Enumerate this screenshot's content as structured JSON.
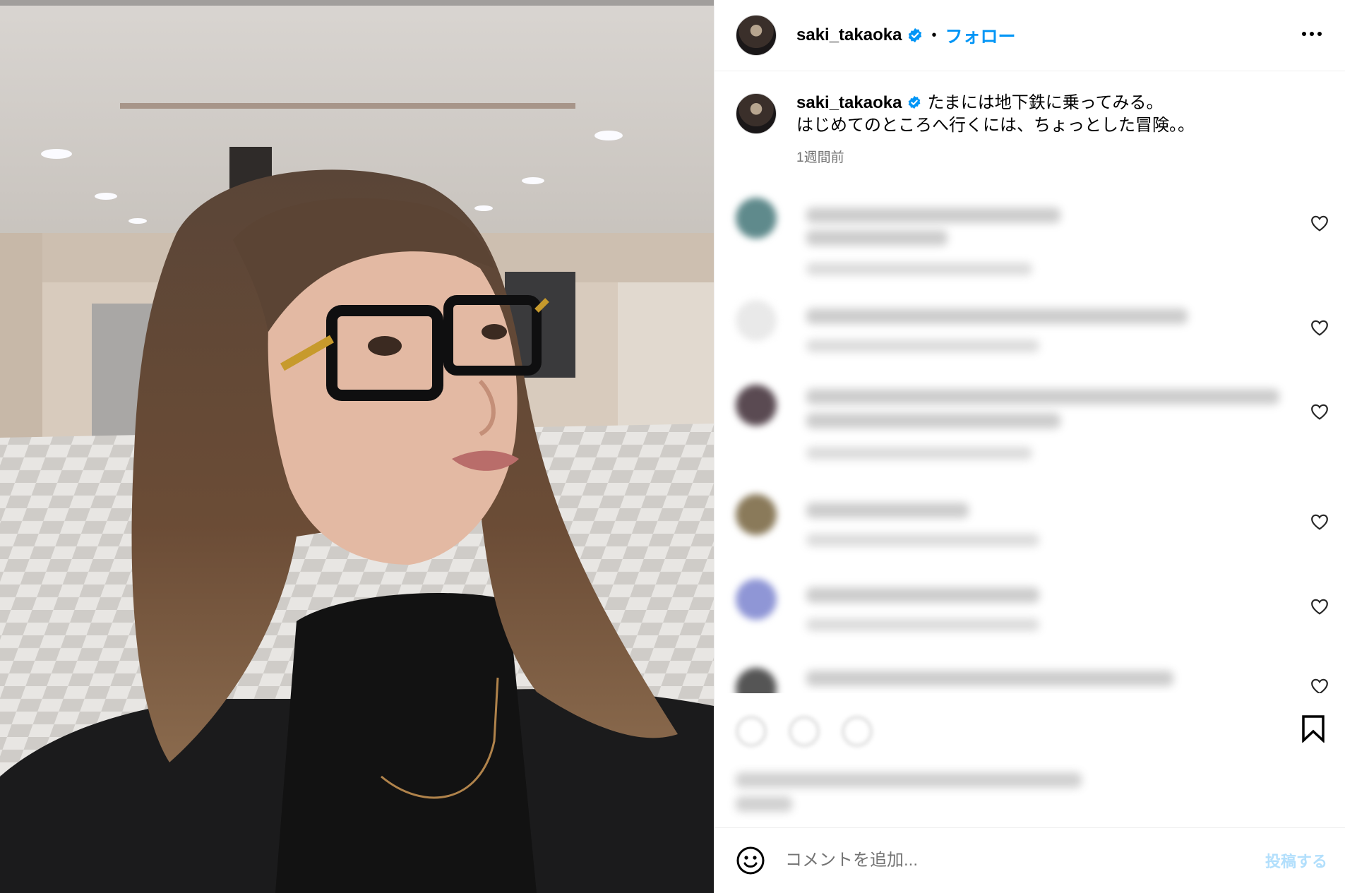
{
  "header": {
    "username": "saki_takaoka",
    "separator": "•",
    "follow_label": "フォロー"
  },
  "caption": {
    "username": "saki_takaoka",
    "line1": "たまには地下鉄に乗ってみる。",
    "line2": "はじめてのところへ行くには、ちょっとした冒険。。",
    "time": "1週間前"
  },
  "composer": {
    "placeholder": "コメントを追加...",
    "post_label": "投稿する"
  },
  "colors": {
    "accent": "#0095f6",
    "verified": "#0095f6",
    "post_disabled": "#b2dffc"
  },
  "icons": [
    "more-options-icon",
    "verified-badge-icon",
    "heart-icon",
    "bookmark-icon",
    "emoji-icon"
  ]
}
